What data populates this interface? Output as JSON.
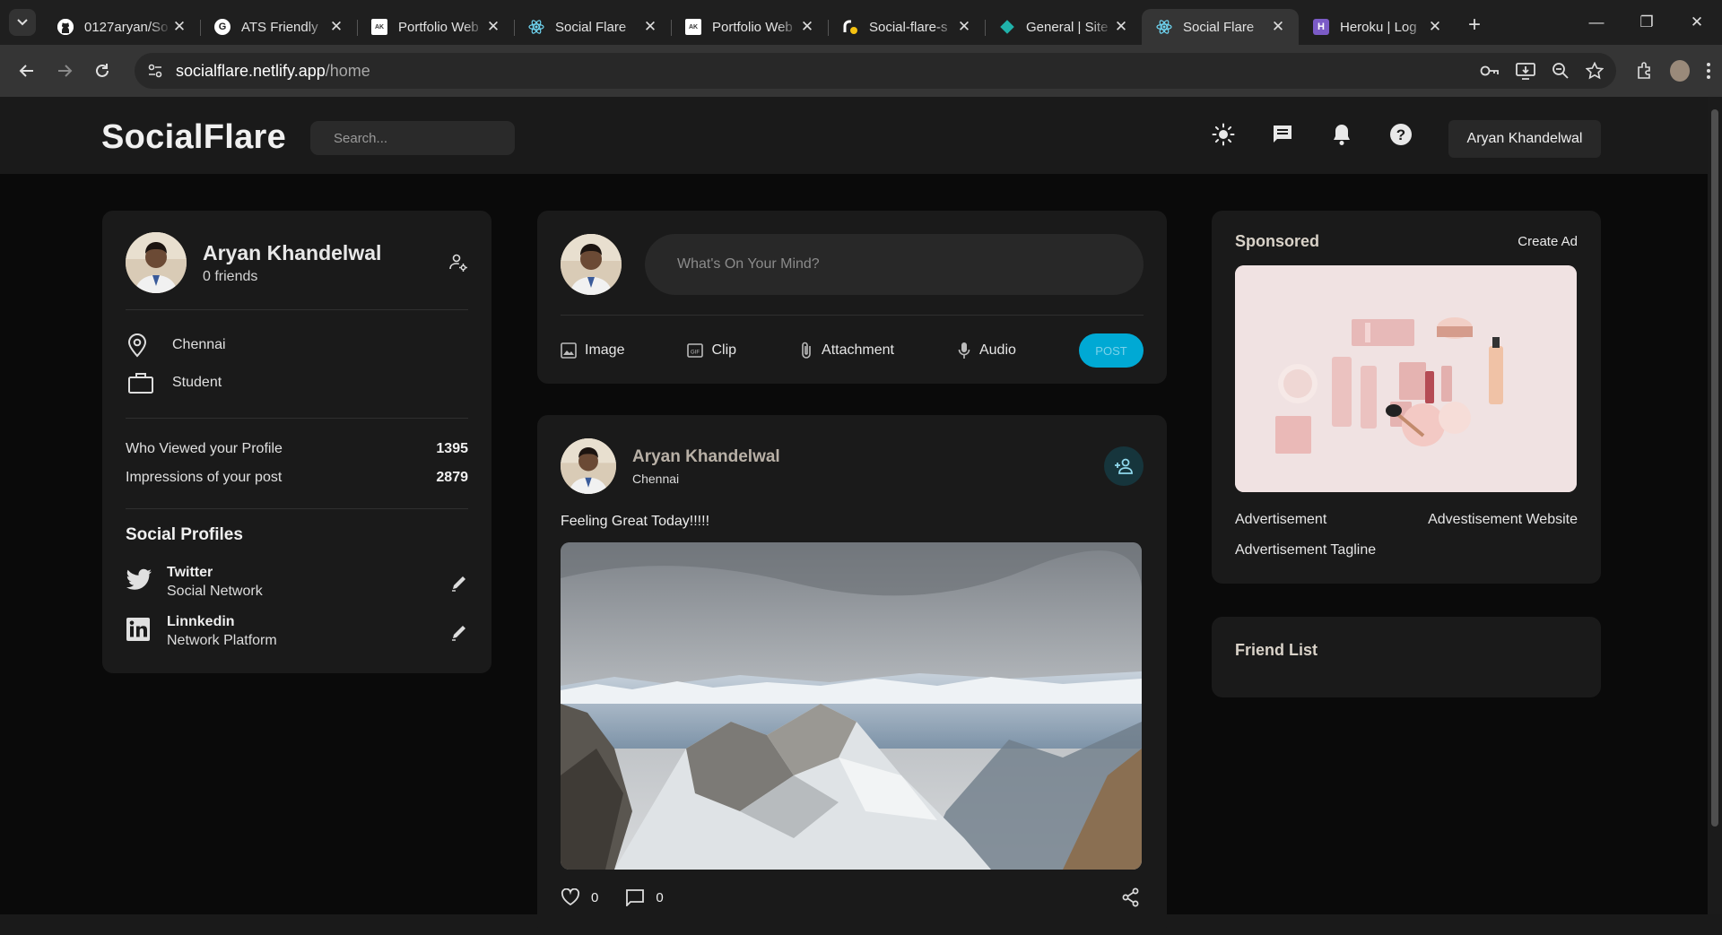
{
  "browser": {
    "tabs": [
      {
        "title": "0127aryan/So",
        "favicon": "github-icon",
        "active": false
      },
      {
        "title": "ATS Friendly",
        "favicon": "chrome-doc-icon",
        "active": false
      },
      {
        "title": "Portfolio Web",
        "favicon": "portfolio-icon",
        "active": false
      },
      {
        "title": "Social Flare",
        "favicon": "react-icon",
        "active": false
      },
      {
        "title": "Portfolio Web",
        "favicon": "portfolio-icon",
        "active": false
      },
      {
        "title": "Social-flare-s",
        "favicon": "render-icon",
        "active": false
      },
      {
        "title": "General | Site",
        "favicon": "netlify-icon",
        "active": false
      },
      {
        "title": "Social Flare",
        "favicon": "react-icon",
        "active": true
      },
      {
        "title": "Heroku | Log",
        "favicon": "heroku-icon",
        "active": false
      }
    ],
    "url_host": "socialflare.netlify.app",
    "url_path": "/home"
  },
  "app": {
    "logo": "SocialFlare",
    "search_placeholder": "Search...",
    "user_select": "Aryan Khandelwal"
  },
  "profile": {
    "name": "Aryan Khandelwal",
    "friends": "0 friends",
    "location": "Chennai",
    "occupation": "Student",
    "stats": [
      {
        "label": "Who Viewed your Profile",
        "value": "1395"
      },
      {
        "label": "Impressions of your post",
        "value": "2879"
      }
    ],
    "social_title": "Social Profiles",
    "socials": [
      {
        "name": "Twitter",
        "desc": "Social Network"
      },
      {
        "name": "Linnkedin",
        "desc": "Network Platform"
      }
    ]
  },
  "composer": {
    "placeholder": "What's On Your Mind?",
    "actions": [
      "Image",
      "Clip",
      "Attachment",
      "Audio"
    ],
    "post_label": "POST"
  },
  "post": {
    "author": "Aryan Khandelwal",
    "location": "Chennai",
    "text": "Feeling Great Today!!!!!",
    "likes": "0",
    "comments": "0"
  },
  "sponsored": {
    "title": "Sponsored",
    "create_ad": "Create Ad",
    "ad_name": "Advertisement",
    "ad_website": "Advestisement Website",
    "ad_tagline": "Advertisement Tagline"
  },
  "friend_list": {
    "title": "Friend List"
  },
  "colors": {
    "accent": "#00a9d4",
    "background": "#0a0a0a",
    "card": "#1a1a1a"
  }
}
